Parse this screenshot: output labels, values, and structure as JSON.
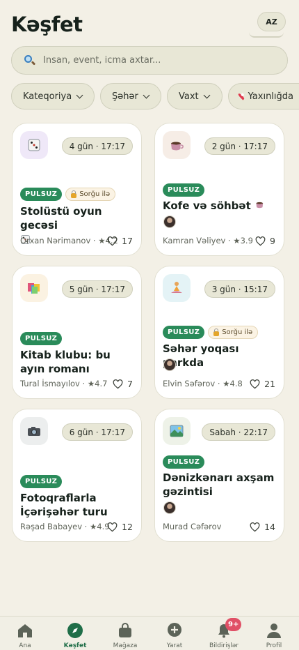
{
  "header": {
    "title": "Kəşfet",
    "lang": "AZ"
  },
  "search": {
    "placeholder": "İnsan, event, icma axtar..."
  },
  "filters": [
    {
      "label": "Kateqoriya",
      "icon": "chevron-down-icon"
    },
    {
      "label": "Şəhər",
      "icon": "chevron-down-icon"
    },
    {
      "label": "Vaxt",
      "icon": "chevron-down-icon"
    },
    {
      "label": "Yaxınlığda",
      "icon": "location-pin-icon"
    }
  ],
  "events": [
    {
      "icon": "game-die-icon",
      "time": "4 gün · 17:17",
      "free": "PULSUZ",
      "request": "Sorğu ilə",
      "title": "Stolüstü oyun gecəsi",
      "host": "Orxan Nərimanov · ★4.2",
      "likes": "17"
    },
    {
      "icon": "coffee-icon",
      "time": "2 gün · 17:17",
      "free": "PULSUZ",
      "title": "Kofe və söhbət",
      "host": "Kamran Vəliyev · ★3.9",
      "likes": "9"
    },
    {
      "icon": "books-icon",
      "time": "5 gün · 17:17",
      "free": "PULSUZ",
      "title": "Kitab klubu: bu ayın romanı",
      "host": "Tural İsmayılov · ★4.7",
      "likes": "7"
    },
    {
      "icon": "yoga-icon",
      "time": "3 gün · 15:17",
      "free": "PULSUZ",
      "request": "Sorğu ilə",
      "title": "Səhər yoqası parkda",
      "host": "Elvin Səfərov · ★4.8",
      "likes": "21"
    },
    {
      "icon": "camera-icon",
      "time": "6 gün · 17:17",
      "free": "PULSUZ",
      "title": "Fotoqraflarla İçərişəhər turu",
      "host": "Rəşad Babayev · ★4.9",
      "likes": "12"
    },
    {
      "icon": "seaside-picture-icon",
      "time": "Sabah · 22:17",
      "free": "PULSUZ",
      "title": "Dənizkənarı axşam gəzintisi",
      "host": "Murad Cəfərov",
      "likes": "14"
    }
  ],
  "tabbar": [
    {
      "label": "Ana",
      "icon": "home-icon"
    },
    {
      "label": "Kəşfet",
      "icon": "compass-icon",
      "active": true
    },
    {
      "label": "Mağaza",
      "icon": "shopping-bag-icon"
    },
    {
      "label": "Yarat",
      "icon": "plus-circle-icon"
    },
    {
      "label": "Bildirişlər",
      "icon": "bell-icon",
      "badge": "9+"
    },
    {
      "label": "Profil",
      "icon": "person-icon"
    }
  ],
  "colors": {
    "accent": "#2a8b5a",
    "background": "#f3f0e6",
    "badge": "#e05066"
  }
}
